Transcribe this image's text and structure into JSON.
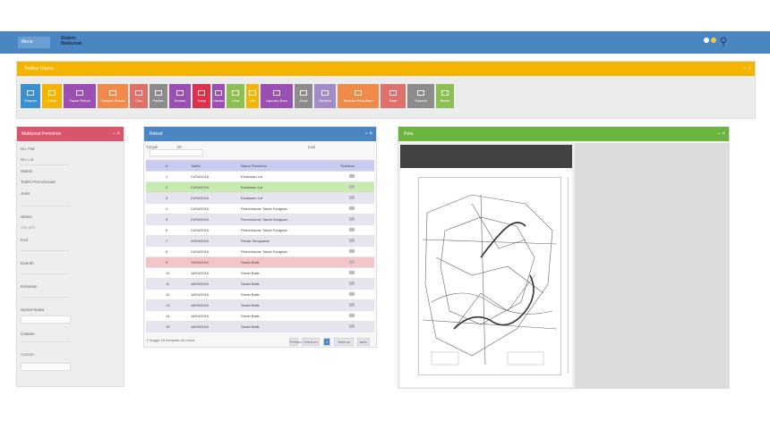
{
  "topbar": {
    "menu_label": "Menu",
    "logo_line1": "Sistem",
    "logo_line2": "Maklumat"
  },
  "toolbar": {
    "title": "Toolbar Utama",
    "buttons": [
      {
        "label": "Simpan",
        "color": "#3a8fd1",
        "w": 22
      },
      {
        "label": "Cetak",
        "color": "#f4b400",
        "w": 22
      },
      {
        "label": "Papar Rekod",
        "color": "#9b4fb3",
        "w": 36
      },
      {
        "label": "Tambah Rekod",
        "color": "#f08a4b",
        "w": 34
      },
      {
        "label": "Cari",
        "color": "#e0706b",
        "w": 20
      },
      {
        "label": "Padam",
        "color": "#8c8c8c",
        "w": 20
      },
      {
        "label": "Kemas",
        "color": "#9b4fb3",
        "w": 24
      },
      {
        "label": "Tutup",
        "color": "#e0304a",
        "w": 20
      },
      {
        "label": "Hantar",
        "color": "#9b4fb3",
        "w": 14
      },
      {
        "label": "Lihat",
        "color": "#8cc152",
        "w": 20
      },
      {
        "label": "Info",
        "color": "#f4b400",
        "w": 14
      },
      {
        "label": "Laporan Baru",
        "color": "#9b4fb3",
        "w": 36
      },
      {
        "label": "Muat",
        "color": "#8c8c8c",
        "w": 20
      },
      {
        "label": "Senarai",
        "color": "#a48cc9",
        "w": 24
      },
      {
        "label": "Tambah Peta Baru",
        "color": "#f08a4b",
        "w": 46
      },
      {
        "label": "Salin",
        "color": "#e0706b",
        "w": 28
      },
      {
        "label": "Sejarah",
        "color": "#8c8c8c",
        "w": 30
      },
      {
        "label": "Bantu",
        "color": "#8cc152",
        "w": 20
      }
    ]
  },
  "form": {
    "title": "Maklumat Pemohon",
    "rows": [
      "No. Fail",
      "No. Lot",
      "Mukim",
      "Tarikh Permohonan",
      "Jenis"
    ],
    "labels": [
      "Status",
      "Kod",
      "Daerah",
      "Keluasan",
      "Syarat Nyata",
      "Catatan"
    ],
    "placeholder": "Sila pilih"
  },
  "table": {
    "title": "Rekod",
    "filter_label": "Tunjuk",
    "filter_value": "10",
    "search_label": "Cari",
    "columns": [
      "#",
      "Tarikh",
      "Nama Pemohon",
      "Tindakan"
    ],
    "rows": [
      {
        "num": "1",
        "date": "21/04/2016",
        "name": "Kelulusan Lot",
        "bg": "#ffffff"
      },
      {
        "num": "2",
        "date": "21/04/2016",
        "name": "Kelulusan Lot",
        "bg": "#c7ebaf"
      },
      {
        "num": "3",
        "date": "21/04/2016",
        "name": "Kelulusan Lot",
        "bg": "#e4e5ef"
      },
      {
        "num": "4",
        "date": "21/04/2016",
        "name": "Permohonan Tanah Kerajaan",
        "bg": "#ffffff"
      },
      {
        "num": "5",
        "date": "21/04/2016",
        "name": "Permohonan Tanah Kerajaan",
        "bg": "#e4e5ef"
      },
      {
        "num": "6",
        "date": "21/04/2016",
        "name": "Permohonan Tanah Kerajaan",
        "bg": "#ffffff"
      },
      {
        "num": "7",
        "date": "20/04/2016",
        "name": "Pecah Sempadan",
        "bg": "#e4e5ef"
      },
      {
        "num": "8",
        "date": "21/04/2016",
        "name": "Permohonan Tanah Kerajaan",
        "bg": "#ffffff"
      },
      {
        "num": "9",
        "date": "19/04/2016",
        "name": "Serah Balik",
        "bg": "#f5c4c9"
      },
      {
        "num": "10",
        "date": "18/04/2016",
        "name": "Serah Balik",
        "bg": "#ffffff"
      },
      {
        "num": "11",
        "date": "18/04/2016",
        "name": "Serah Balik",
        "bg": "#e4e5ef"
      },
      {
        "num": "12",
        "date": "18/04/2016",
        "name": "Serah Balik",
        "bg": "#ffffff"
      },
      {
        "num": "13",
        "date": "18/04/2016",
        "name": "Serah Balik",
        "bg": "#e4e5ef"
      },
      {
        "num": "14",
        "date": "18/04/2016",
        "name": "Serah Balik",
        "bg": "#ffffff"
      },
      {
        "num": "15",
        "date": "18/04/2016",
        "name": "Serah Balik",
        "bg": "#e4e5ef"
      }
    ],
    "footer_info": "1 hingga 15 daripada 40 rekod",
    "pages": [
      "Pertama",
      "Sebelum",
      "1",
      "Seterus",
      "Akhir"
    ]
  },
  "map": {
    "title": "Peta"
  },
  "colors": {
    "topbar": "#4b86c2",
    "toolbar_head": "#f4b400",
    "form_head": "#d9556b",
    "table_head": "#4b86c2",
    "map_head": "#6ab43f"
  }
}
